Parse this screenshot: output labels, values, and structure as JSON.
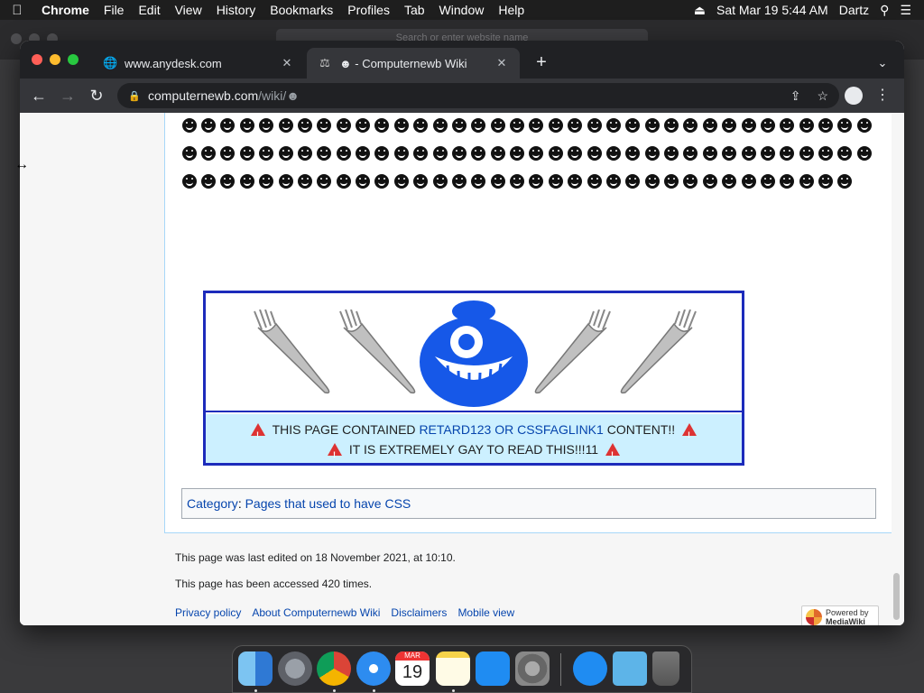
{
  "menubar": {
    "app_name": "Chrome",
    "items": [
      "File",
      "Edit",
      "View",
      "History",
      "Bookmarks",
      "Profiles",
      "Tab",
      "Window",
      "Help"
    ],
    "clock": "Sat Mar 19  5:44 AM",
    "user": "Dartz"
  },
  "background_window": {
    "search_placeholder": "Search or enter website name"
  },
  "browser": {
    "tabs": [
      {
        "title": "www.anydesk.com",
        "active": false
      },
      {
        "title": "☻ - Computernewb Wiki",
        "active": true
      }
    ],
    "url_host": "computernewb.com",
    "url_path": "/wiki/☻"
  },
  "page": {
    "smiley_count": 107,
    "warning": {
      "line1_prefix": "THIS PAGE CONTAINED ",
      "line1_link": "RETARD123 OR CSSFAGLINK1",
      "line1_suffix": " CONTENT!!",
      "line2": "IT IS EXTREMELY GAY TO READ THIS!!!11"
    },
    "category_label": "Category",
    "category_value": "Pages that used to have CSS",
    "last_edited": "This page was last edited on 18 November 2021, at 10:10.",
    "access_count": "This page has been accessed 420 times.",
    "footer_links": [
      "Privacy policy",
      "About Computernewb Wiki",
      "Disclaimers",
      "Mobile view"
    ],
    "powered_by_line1": "Powered by",
    "powered_by_line2": "MediaWiki"
  },
  "colors": {
    "warning_border": "#1c2bbb",
    "warning_bg": "#ccf0ff",
    "link": "#0645ad"
  },
  "dock": {
    "apps": [
      "finder-icon",
      "launchpad-icon",
      "chrome-icon",
      "safari-icon",
      "calendar-icon",
      "notes-icon",
      "app-store-icon",
      "system-preferences-icon",
      "app-store-download-icon",
      "downloads-folder-icon",
      "trash-icon"
    ],
    "calendar_month": "MAR",
    "calendar_day": "19"
  }
}
